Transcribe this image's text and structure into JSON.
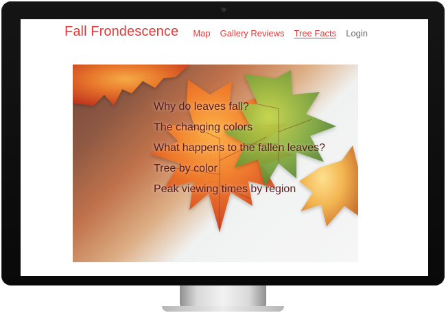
{
  "site": {
    "title": "Fall Frondescence"
  },
  "nav": {
    "items": [
      {
        "label": "Map",
        "active": false
      },
      {
        "label": "Gallery Reviews",
        "active": false
      },
      {
        "label": "Tree Facts",
        "active": true
      },
      {
        "label": "Login",
        "active": false
      }
    ]
  },
  "hero": {
    "menu": [
      "Why do leaves fall?",
      "The changing colors",
      "What happens to the fallen leaves?",
      "Tree by color",
      "Peak viewing times by region"
    ]
  },
  "colors": {
    "brand_red": "#e03b3b",
    "menu_text": "#5a1c1c",
    "login_gray": "#6a6a6a"
  },
  "icons": {
    "camera": "camera-dot"
  }
}
